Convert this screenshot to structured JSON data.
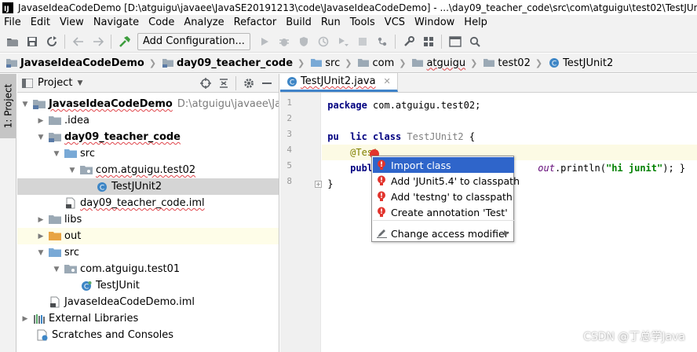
{
  "window": {
    "title": "JavaseIdeaCodeDemo [D:\\atguigu\\javaee\\JavaSE20191213\\code\\JavaseIdeaCodeDemo] - ...\\day09_teacher_code\\src\\com\\atguigu\\test02\\TestJUnit2.ja"
  },
  "menu": {
    "file": "File",
    "edit": "Edit",
    "view": "View",
    "navigate": "Navigate",
    "code": "Code",
    "analyze": "Analyze",
    "refactor": "Refactor",
    "build": "Build",
    "run": "Run",
    "tools": "Tools",
    "vcs": "VCS",
    "window": "Window",
    "help": "Help"
  },
  "toolbar": {
    "config_label": "Add Configuration..."
  },
  "breadcrumbs": {
    "project": "JavaseIdeaCodeDemo",
    "module": "day09_teacher_code",
    "src": "src",
    "com": "com",
    "atguigu": "atguigu",
    "test02": "test02",
    "file": "TestJUnit2"
  },
  "side_strip": {
    "tab_label": "1: Project"
  },
  "project_panel": {
    "title": "Project",
    "tree": {
      "root": "JavaseIdeaCodeDemo",
      "root_path": "D:\\atguigu\\javaee\\JavaSE2",
      "idea": ".idea",
      "module": "day09_teacher_code",
      "module_src": "src",
      "module_pkg": "com.atguigu.test02",
      "module_class": "TestJUnit2",
      "module_iml": "day09_teacher_code.iml",
      "libs": "libs",
      "out": "out",
      "src": "src",
      "pkg": "com.atguigu.test01",
      "class": "TestJUnit",
      "project_iml": "JavaseIdeaCodeDemo.iml",
      "external": "External Libraries",
      "scratches": "Scratches and Consoles"
    }
  },
  "editor": {
    "tab_label": "TestJUnit2.java",
    "line_numbers": {
      "l1": "1",
      "l2": "2",
      "l3": "3",
      "l4": "4",
      "l5": "5",
      "l8": "8"
    },
    "code": {
      "pkg_kw": "package",
      "pkg_name": " com.atguigu.test02;",
      "class_kw_a": "pu",
      "class_kw_b": "lic class",
      "class_name": " TestJUnit2",
      "class_brace": " {",
      "annotation": "@Test",
      "method_kw": "publi",
      "method_tail_obj": "out",
      "method_tail_call": ".println(",
      "method_string": "\"hi junit\"",
      "method_end": "); }",
      "close_brace": "}"
    }
  },
  "intention_popup": {
    "items": [
      {
        "label": "Import class"
      },
      {
        "label": "Add 'JUnit5.4' to classpath"
      },
      {
        "label": "Add 'testng' to classpath"
      },
      {
        "label": "Create annotation 'Test'"
      },
      {
        "label": "Change access modifier"
      }
    ]
  },
  "watermark": "CSDN @丁总学Java",
  "colors": {
    "selection": "#2f65ca",
    "error": "#e2342d",
    "folder": "#9ba9b5",
    "out_folder": "#e8a443",
    "src_folder": "#79a9d6",
    "class_icon": "#3e86c6"
  }
}
